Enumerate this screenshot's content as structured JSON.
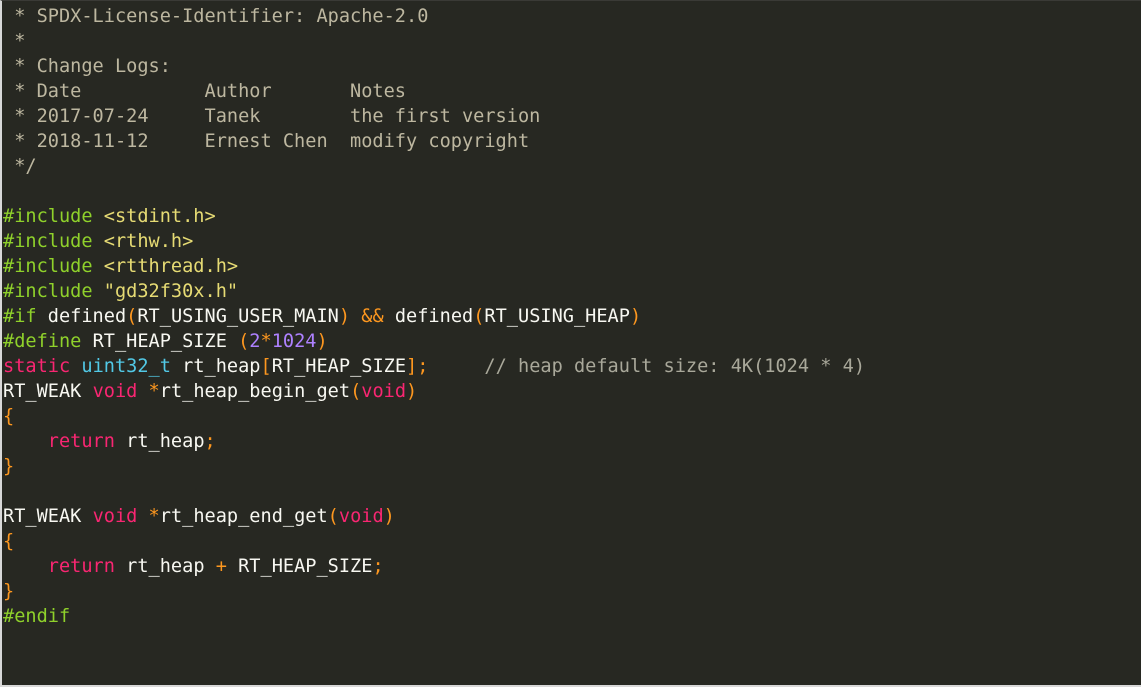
{
  "editor": {
    "colors": {
      "background": "#272822",
      "comment": "#bdb7a0",
      "preprocessor": "#8fd12b",
      "string": "#e6db74",
      "punctuation": "#fd971f",
      "number": "#ae81ff",
      "keyword": "#f92672",
      "type": "#52c9e6",
      "default": "#f8f8f2"
    },
    "lines": [
      [
        [
          " * SPDX-License-Identifier: Apache-2.0",
          "c"
        ]
      ],
      [
        [
          " *",
          "c"
        ]
      ],
      [
        [
          " * Change Logs:",
          "c"
        ]
      ],
      [
        [
          " * Date           Author       Notes",
          "c"
        ]
      ],
      [
        [
          " * 2017-07-24     Tanek        the first version",
          "c"
        ]
      ],
      [
        [
          " * 2018-11-12     Ernest Chen  modify copyright",
          "c"
        ]
      ],
      [
        [
          " */",
          "c"
        ]
      ],
      [],
      [
        [
          "#include ",
          "p"
        ],
        [
          "<stdint.h>",
          "s"
        ]
      ],
      [
        [
          "#include ",
          "p"
        ],
        [
          "<rthw.h>",
          "s"
        ]
      ],
      [
        [
          "#include ",
          "p"
        ],
        [
          "<rtthread.h>",
          "s"
        ]
      ],
      [
        [
          "#include ",
          "p"
        ],
        [
          "\"gd32f30x.h\"",
          "s"
        ]
      ],
      [
        [
          "#if ",
          "p"
        ],
        [
          "defined",
          "d"
        ],
        [
          "(",
          "o"
        ],
        [
          "RT_USING_USER_MAIN",
          "d"
        ],
        [
          ")",
          "o"
        ],
        [
          " ",
          "d"
        ],
        [
          "&&",
          "o"
        ],
        [
          " defined",
          "d"
        ],
        [
          "(",
          "o"
        ],
        [
          "RT_USING_HEAP",
          "d"
        ],
        [
          ")",
          "o"
        ]
      ],
      [
        [
          "#define ",
          "p"
        ],
        [
          "RT_HEAP_SIZE ",
          "d"
        ],
        [
          "(",
          "o"
        ],
        [
          "2",
          "n"
        ],
        [
          "*",
          "o"
        ],
        [
          "1024",
          "n"
        ],
        [
          ")",
          "o"
        ]
      ],
      [
        [
          "static ",
          "k"
        ],
        [
          "uint32_t ",
          "t"
        ],
        [
          "rt_heap",
          "d"
        ],
        [
          "[",
          "o"
        ],
        [
          "RT_HEAP_SIZE",
          "d"
        ],
        [
          "];",
          "o"
        ],
        [
          "     ",
          "d"
        ],
        [
          "// heap default size: 4K(1024 * 4)",
          "cm"
        ]
      ],
      [
        [
          "RT_WEAK ",
          "d"
        ],
        [
          "void ",
          "k"
        ],
        [
          "*",
          "o"
        ],
        [
          "rt_heap_begin_get",
          "d"
        ],
        [
          "(",
          "o"
        ],
        [
          "void",
          "k"
        ],
        [
          ")",
          "o"
        ]
      ],
      [
        [
          "{",
          "o"
        ]
      ],
      [
        [
          "    ",
          "d"
        ],
        [
          "return ",
          "k"
        ],
        [
          "rt_heap",
          "d"
        ],
        [
          ";",
          "o"
        ]
      ],
      [
        [
          "}",
          "o"
        ]
      ],
      [],
      [
        [
          "RT_WEAK ",
          "d"
        ],
        [
          "void ",
          "k"
        ],
        [
          "*",
          "o"
        ],
        [
          "rt_heap_end_get",
          "d"
        ],
        [
          "(",
          "o"
        ],
        [
          "void",
          "k"
        ],
        [
          ")",
          "o"
        ]
      ],
      [
        [
          "{",
          "o"
        ]
      ],
      [
        [
          "    ",
          "d"
        ],
        [
          "return ",
          "k"
        ],
        [
          "rt_heap ",
          "d"
        ],
        [
          "+",
          "o"
        ],
        [
          " RT_HEAP_SIZE",
          "d"
        ],
        [
          ";",
          "o"
        ]
      ],
      [
        [
          "}",
          "o"
        ]
      ],
      [
        [
          "#endif",
          "p"
        ]
      ]
    ]
  }
}
